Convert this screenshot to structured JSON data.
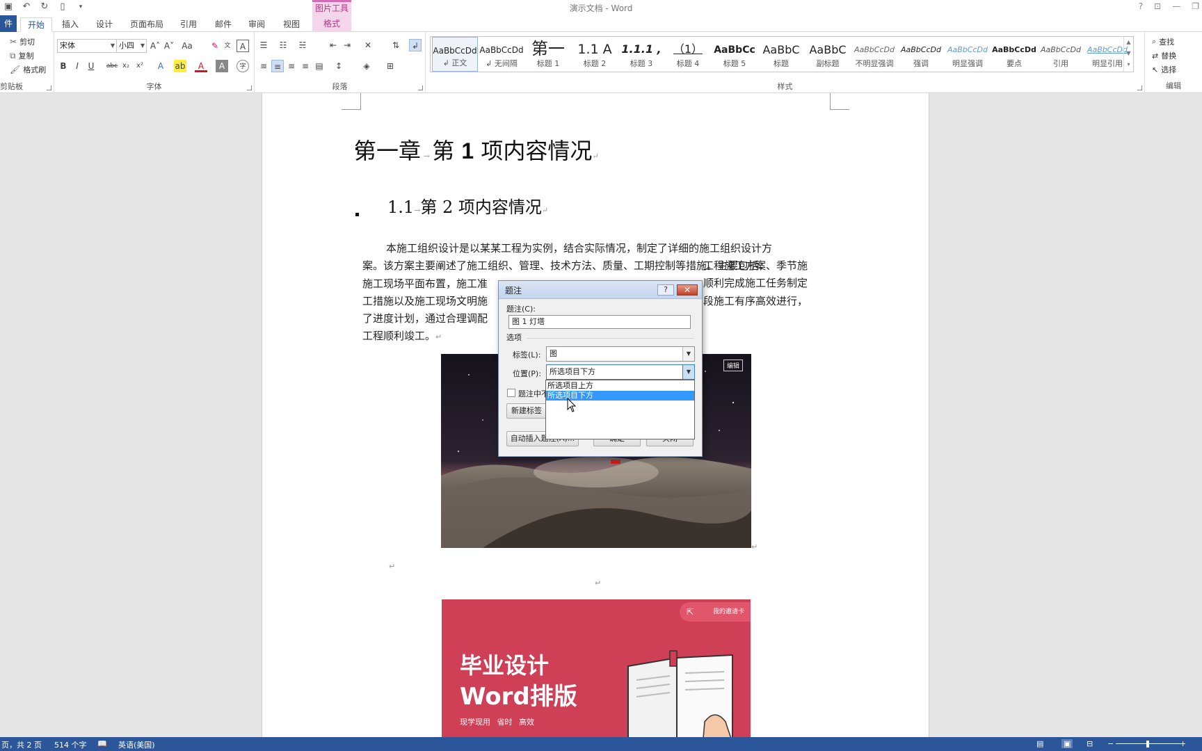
{
  "window": {
    "title": "演示文档 - Word",
    "contextual_tab_group": "图片工具"
  },
  "tabs": [
    "件",
    "开始",
    "插入",
    "设计",
    "页面布局",
    "引用",
    "邮件",
    "审阅",
    "视图",
    "格式"
  ],
  "active_tab": "开始",
  "ribbon": {
    "clipboard": {
      "label": "剪贴板",
      "cut": "剪切",
      "copy": "复制",
      "format_painter": "格式刷"
    },
    "font": {
      "label": "字体",
      "font_name": "宋体",
      "font_size": "小四"
    },
    "paragraph": {
      "label": "段落"
    },
    "styles": {
      "label": "样式",
      "items": [
        {
          "sample": "AaBbCcDd",
          "name": "↲ 正文"
        },
        {
          "sample": "AaBbCcDd",
          "name": "↲ 无间隔"
        },
        {
          "sample": "第一",
          "name": "标题 1"
        },
        {
          "sample": "1.1 A",
          "name": "标题 2"
        },
        {
          "sample": "1.1.1 ,",
          "name": "标题 3"
        },
        {
          "sample": "（1）",
          "name": "标题 4"
        },
        {
          "sample": "AaBbCc",
          "name": "标题 5"
        },
        {
          "sample": "AaBbC",
          "name": "标题"
        },
        {
          "sample": "AaBbC",
          "name": "副标题"
        },
        {
          "sample": "AaBbCcDd",
          "name": "不明显强调"
        },
        {
          "sample": "AaBbCcDd",
          "name": "强调"
        },
        {
          "sample": "AaBbCcDd",
          "name": "明显强调"
        },
        {
          "sample": "AaBbCcDd",
          "name": "要点"
        },
        {
          "sample": "AaBbCcDd",
          "name": "引用"
        },
        {
          "sample": "AaBbCcDd",
          "name": "明显引用"
        }
      ]
    },
    "editing": {
      "label": "编辑",
      "find": "查找",
      "replace": "替换",
      "select": "选择"
    }
  },
  "document": {
    "heading1_prefix": "第一章",
    "heading1_mid": "第",
    "heading1_num": "1",
    "heading1_suffix": "项内容情况",
    "heading2_num": "1.1",
    "heading2_text": "第 2 项内容情况",
    "paragraph": "本施工组织设计是以某某工程为实例，结合实际情况，制定了详细的施工组织设计方案。该方案主要阐述了施工组织、管理、技术方法、质量、工期控制等措施。主要包括：施工现场平面布置，施工准备情况，施工进度计划，主要施工方法，分部分项工程施工方案、季节施工措施以及施工现场文明施工措施等。为了保证工程项目在规定的工期内顺利完成施工任务制定了进度计划，通过合理调配人力、物力、财力等资源配置，使各分项工程各阶段施工有序高效进行，工程顺利竣工。",
    "paragraph_lines": [
      "本施工组织设计是以某某工程为实例，结合实际情况，制定了详细的施工组织设计方",
      "案。该方案主要阐述了施工组织、管理、技术方法、质量、工期控制等措施。主要包括：",
      "施工现场平面布置，施工准",
      "工措施以及施工现场文明施",
      "了进度计划，通过合理调配",
      "工程顺利竣工。"
    ],
    "paragraph_right_fragments": [
      "工程施工方案、季节施",
      "顺利完成施工任务制定",
      "段施工有序高效进行，"
    ],
    "image_badge": "编辑",
    "promo": {
      "pill": "我的邀请卡",
      "title_line1": "毕业设计",
      "title_line2": "Word排版",
      "subtitle": "现学现用 省时 高效"
    }
  },
  "dialog": {
    "title": "题注",
    "help": "?",
    "caption_label": "题注(C):",
    "caption_value": "图 1 灯塔",
    "options_label": "选项",
    "label_label": "标签(L):",
    "label_value": "图",
    "position_label": "位置(P):",
    "position_value": "所选项目下方",
    "position_options": [
      "所选项目上方",
      "所选项目下方"
    ],
    "exclude_label_text": "题注中不",
    "new_label_button": "新建标签",
    "autocaption_button": "自动插入题注(A)...",
    "ok_button": "确定",
    "cancel_button": "关闭"
  },
  "statusbar": {
    "page": "页，共 2 页",
    "word_count": "514 个字",
    "language": "英语(美国)"
  }
}
